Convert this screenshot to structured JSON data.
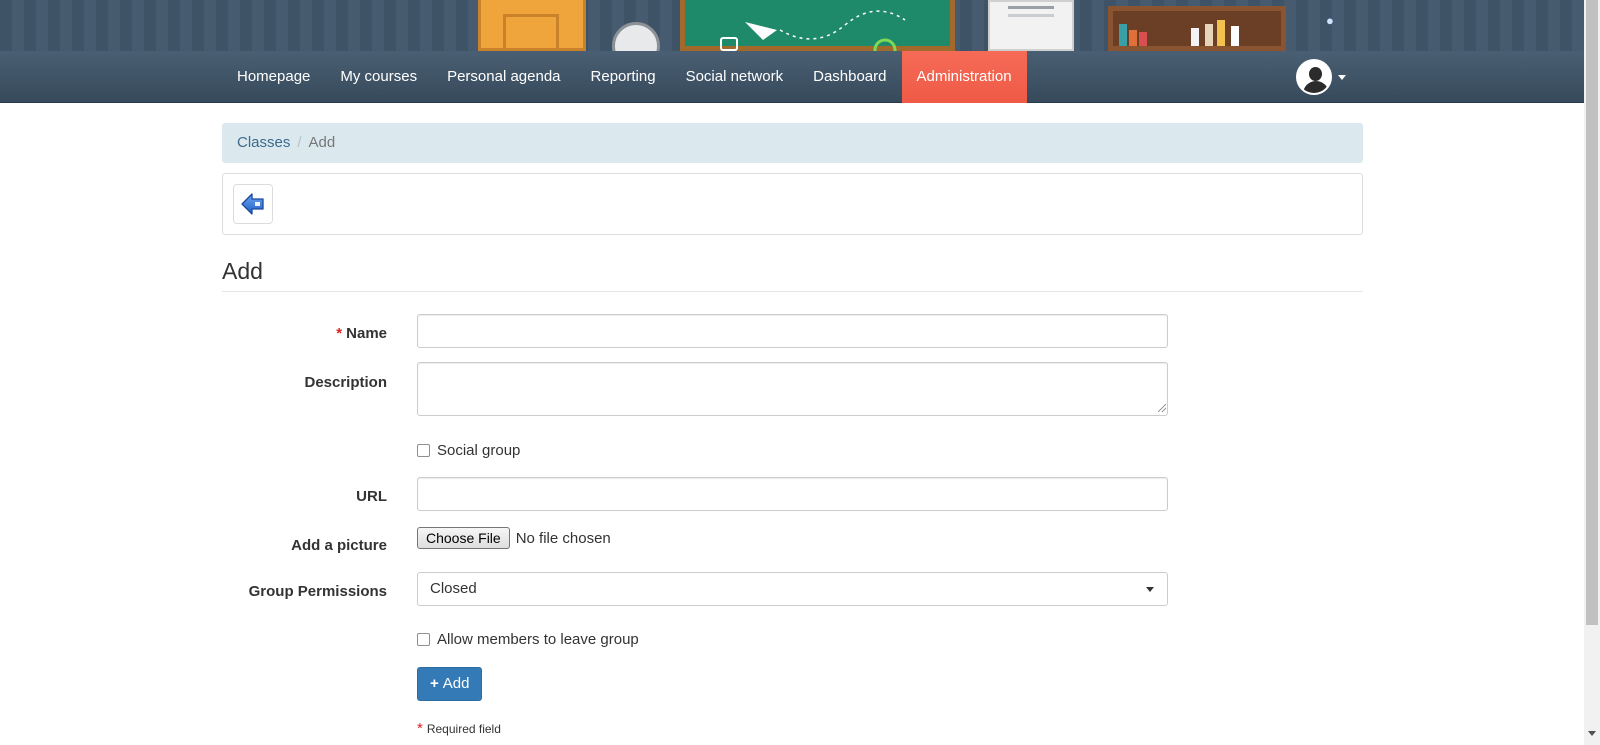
{
  "nav": {
    "items": [
      {
        "label": "Homepage"
      },
      {
        "label": "My courses"
      },
      {
        "label": "Personal agenda"
      },
      {
        "label": "Reporting"
      },
      {
        "label": "Social network"
      },
      {
        "label": "Dashboard"
      },
      {
        "label": "Administration",
        "active": true
      }
    ],
    "active_color": "#f0624f"
  },
  "breadcrumb": {
    "items": [
      "Classes",
      "Add"
    ],
    "separator": "/"
  },
  "toolbar": {
    "back_icon": "arrow-left-icon"
  },
  "page": {
    "title": "Add"
  },
  "form": {
    "name_label": "Name",
    "required_marker": "*",
    "name_value": "",
    "description_label": "Description",
    "description_value": "",
    "social_group_label": "Social group",
    "social_group_checked": false,
    "url_label": "URL",
    "url_value": "",
    "picture_label": "Add a picture",
    "file_button_label": "Choose File",
    "file_status": "No file chosen",
    "permissions_label": "Group Permissions",
    "permissions_selected": "Closed",
    "allow_leave_label": "Allow members to leave group",
    "allow_leave_checked": false,
    "submit_label": "Add",
    "submit_icon": "plus-icon",
    "required_note": "Required field"
  },
  "colors": {
    "navbar": "#3f5367",
    "breadcrumb_bg": "#dbe9ee",
    "primary_button": "#337ab7",
    "required": "#e02020"
  }
}
